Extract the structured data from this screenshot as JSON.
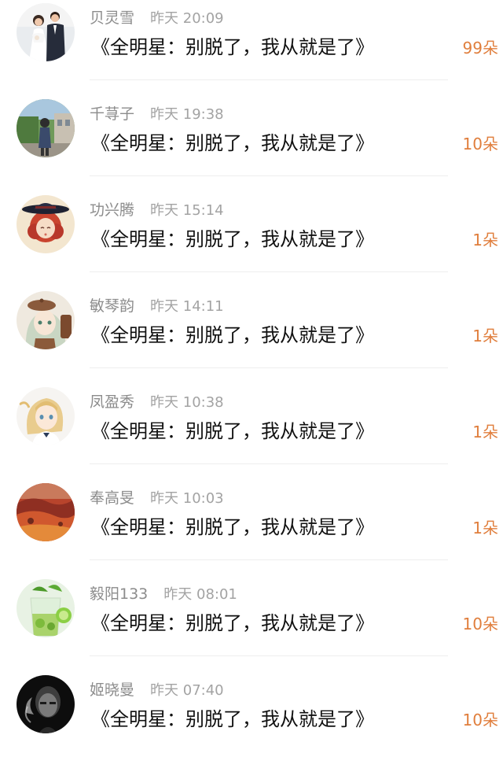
{
  "gift_list": {
    "items": [
      {
        "user": "贝灵雪",
        "time": "昨天 20:09",
        "title": "《全明星：别脱了，我从就是了》",
        "count": "99朵",
        "avatar_icon": "wedding-couple-avatar"
      },
      {
        "user": "千荨子",
        "time": "昨天 19:38",
        "title": "《全明星：别脱了，我从就是了》",
        "count": "10朵",
        "avatar_icon": "street-girl-avatar"
      },
      {
        "user": "功兴腾",
        "time": "昨天 15:14",
        "title": "《全明星：别脱了，我从就是了》",
        "count": "1朵",
        "avatar_icon": "anime-redhead-hat-avatar"
      },
      {
        "user": "敏琴韵",
        "time": "昨天 14:11",
        "title": "《全明星：别脱了，我从就是了》",
        "count": "1朵",
        "avatar_icon": "anime-girl-beret-avatar"
      },
      {
        "user": "凤盈秀",
        "time": "昨天 10:38",
        "title": "《全明星：别脱了，我从就是了》",
        "count": "1朵",
        "avatar_icon": "anime-blonde-girl-avatar"
      },
      {
        "user": "奉高旻",
        "time": "昨天 10:03",
        "title": "《全明星：别脱了，我从就是了》",
        "count": "1朵",
        "avatar_icon": "autumn-landscape-avatar"
      },
      {
        "user": "毅阳133",
        "time": "昨天 08:01",
        "title": "《全明星：别脱了，我从就是了》",
        "count": "10朵",
        "avatar_icon": "mojito-drink-avatar"
      },
      {
        "user": "姬晓曼",
        "time": "昨天 07:40",
        "title": "《全明星：别脱了，我从就是了》",
        "count": "10朵",
        "avatar_icon": "smoking-man-avatar"
      }
    ]
  }
}
